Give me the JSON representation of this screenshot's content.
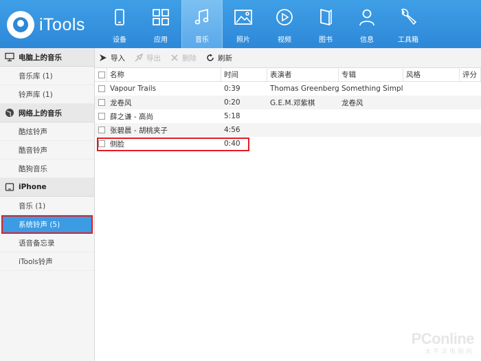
{
  "app": {
    "name": "iTools"
  },
  "nav": [
    {
      "label": "设备",
      "icon": "device-icon",
      "active": false
    },
    {
      "label": "应用",
      "icon": "apps-icon",
      "active": false
    },
    {
      "label": "音乐",
      "icon": "music-icon",
      "active": true
    },
    {
      "label": "照片",
      "icon": "photo-icon",
      "active": false
    },
    {
      "label": "视频",
      "icon": "video-icon",
      "active": false
    },
    {
      "label": "图书",
      "icon": "book-icon",
      "active": false
    },
    {
      "label": "信息",
      "icon": "user-icon",
      "active": false
    },
    {
      "label": "工具箱",
      "icon": "wrench-icon",
      "active": false
    }
  ],
  "sidebar": {
    "sections": [
      {
        "title": "电脑上的音乐",
        "icon": "monitor-icon",
        "items": [
          {
            "label": "音乐库 (1)"
          },
          {
            "label": "铃声库 (1)"
          }
        ]
      },
      {
        "title": "网络上的音乐",
        "icon": "globe-icon",
        "items": [
          {
            "label": "酷炫铃声"
          },
          {
            "label": "酷音铃声"
          },
          {
            "label": "酷狗音乐"
          }
        ]
      },
      {
        "title": "iPhone",
        "icon": "phone-icon",
        "items": [
          {
            "label": "音乐 (1)"
          },
          {
            "label": "系统铃声 (5)",
            "selected": true
          },
          {
            "label": "语音备忘录"
          },
          {
            "label": "iTools铃声"
          }
        ]
      }
    ]
  },
  "toolbar": {
    "import_label": "导入",
    "export_label": "导出",
    "delete_label": "删除",
    "refresh_label": "刷新"
  },
  "table": {
    "columns": [
      "名称",
      "时间",
      "表演者",
      "专辑",
      "风格",
      "评分"
    ],
    "rows": [
      {
        "name": "Vapour Trails",
        "time": "0:39",
        "artist": "Thomas Greenberg",
        "album": "Something Simple",
        "style": "",
        "rating": ""
      },
      {
        "name": "龙卷风",
        "time": "0:20",
        "artist": "G.E.M.邓紫棋",
        "album": "龙卷风",
        "style": "",
        "rating": ""
      },
      {
        "name": "薛之谦 - 高尚",
        "time": "5:18",
        "artist": "",
        "album": "",
        "style": "",
        "rating": ""
      },
      {
        "name": "张碧晨 - 胡桃夹子",
        "time": "4:56",
        "artist": "",
        "album": "",
        "style": "",
        "rating": ""
      },
      {
        "name": "侧脸",
        "time": "0:40",
        "artist": "",
        "album": "",
        "style": "",
        "rating": ""
      }
    ]
  },
  "watermark": {
    "main": "PConline",
    "sub": "太平洋电脑网"
  },
  "colors": {
    "topbar": "#2d88d8",
    "selected": "#3b9be3",
    "highlight": "#e31b23"
  }
}
